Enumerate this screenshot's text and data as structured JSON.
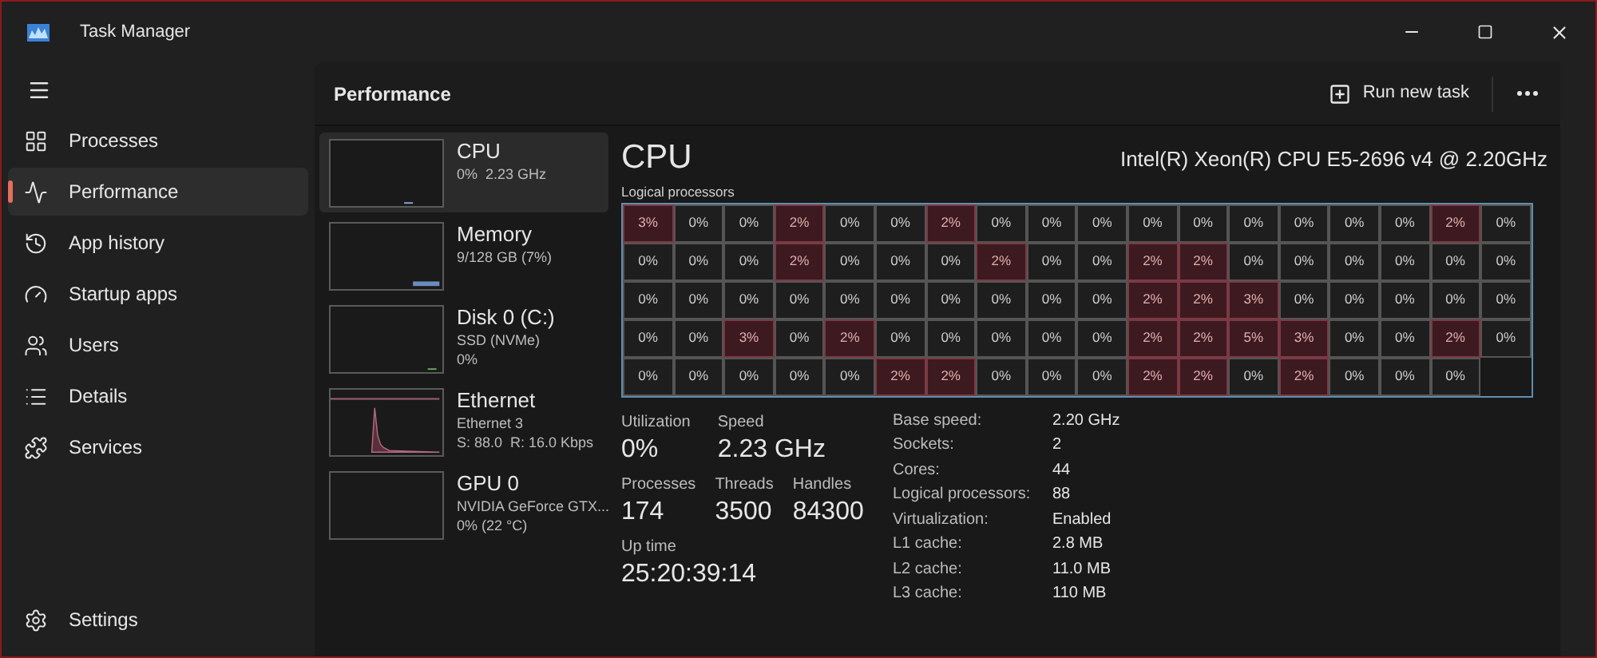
{
  "window": {
    "title": "Task Manager"
  },
  "sidebar": {
    "items": [
      {
        "label": "Processes",
        "kind": "processes",
        "selected": false
      },
      {
        "label": "Performance",
        "kind": "performance",
        "selected": true
      },
      {
        "label": "App history",
        "kind": "history",
        "selected": false
      },
      {
        "label": "Startup apps",
        "kind": "startup",
        "selected": false
      },
      {
        "label": "Users",
        "kind": "users",
        "selected": false
      },
      {
        "label": "Details",
        "kind": "details",
        "selected": false
      },
      {
        "label": "Services",
        "kind": "services",
        "selected": false
      }
    ],
    "footer": {
      "label": "Settings"
    }
  },
  "header": {
    "title": "Performance",
    "run_new_task": "Run new task"
  },
  "devices": [
    {
      "name": "CPU",
      "lines": [
        "0%  2.23 GHz"
      ],
      "kind": "cpu",
      "selected": true
    },
    {
      "name": "Memory",
      "lines": [
        "9/128 GB (7%)"
      ],
      "kind": "memory",
      "selected": false
    },
    {
      "name": "Disk 0 (C:)",
      "lines": [
        "SSD (NVMe)",
        "0%"
      ],
      "kind": "disk",
      "selected": false
    },
    {
      "name": "Ethernet",
      "lines": [
        "Ethernet 3",
        "S: 88.0  R: 16.0 Kbps"
      ],
      "kind": "ethernet",
      "selected": false
    },
    {
      "name": "GPU 0",
      "lines": [
        "NVIDIA GeForce GTX...",
        "0% (22 °C)"
      ],
      "kind": "gpu",
      "selected": false
    }
  ],
  "cpu": {
    "title": "CPU",
    "model": "Intel(R) Xeon(R) CPU E5-2696 v4 @ 2.20GHz",
    "grid_label": "Logical processors",
    "grid": [
      [
        "3%",
        "0%",
        "0%",
        "2%",
        "0%",
        "0%",
        "2%",
        "0%",
        "0%",
        "0%",
        "0%",
        "0%",
        "0%",
        "0%",
        "0%",
        "0%",
        "2%",
        "0%"
      ],
      [
        "0%",
        "0%",
        "0%",
        "2%",
        "0%",
        "0%",
        "0%",
        "2%",
        "0%",
        "0%",
        "2%",
        "2%",
        "0%",
        "0%",
        "0%",
        "0%",
        "0%",
        "0%"
      ],
      [
        "0%",
        "0%",
        "0%",
        "0%",
        "0%",
        "0%",
        "0%",
        "0%",
        "0%",
        "0%",
        "2%",
        "2%",
        "3%",
        "0%",
        "0%",
        "0%",
        "0%",
        "0%"
      ],
      [
        "0%",
        "0%",
        "3%",
        "0%",
        "2%",
        "0%",
        "0%",
        "0%",
        "0%",
        "0%",
        "2%",
        "2%",
        "5%",
        "3%",
        "0%",
        "0%",
        "2%",
        "0%"
      ],
      [
        "0%",
        "0%",
        "0%",
        "0%",
        "0%",
        "2%",
        "2%",
        "0%",
        "0%",
        "0%",
        "2%",
        "2%",
        "0%",
        "2%",
        "0%",
        "0%",
        "0%"
      ]
    ],
    "busy": [
      [
        true,
        false,
        false,
        true,
        false,
        false,
        true,
        false,
        false,
        false,
        false,
        false,
        false,
        false,
        false,
        false,
        true,
        false
      ],
      [
        false,
        false,
        false,
        true,
        false,
        false,
        false,
        true,
        false,
        false,
        true,
        true,
        false,
        false,
        false,
        false,
        false,
        false
      ],
      [
        false,
        false,
        false,
        false,
        false,
        false,
        false,
        false,
        false,
        false,
        true,
        true,
        true,
        false,
        false,
        false,
        false,
        false
      ],
      [
        false,
        false,
        true,
        false,
        true,
        false,
        false,
        false,
        false,
        false,
        true,
        true,
        true,
        true,
        false,
        false,
        true,
        false
      ],
      [
        false,
        false,
        false,
        false,
        false,
        true,
        true,
        false,
        false,
        false,
        true,
        true,
        false,
        true,
        false,
        false,
        false
      ]
    ],
    "stats_top": [
      {
        "label": "Utilization",
        "value": "0%"
      },
      {
        "label": "Speed",
        "value": "2.23 GHz"
      }
    ],
    "stats_mid": [
      {
        "label": "Processes",
        "value": "174"
      },
      {
        "label": "Threads",
        "value": "3500"
      },
      {
        "label": "Handles",
        "value": "84300"
      }
    ],
    "uptime": {
      "label": "Up time",
      "value": "25:20:39:14"
    },
    "specs": [
      {
        "label": "Base speed:",
        "value": "2.20 GHz"
      },
      {
        "label": "Sockets:",
        "value": "2"
      },
      {
        "label": "Cores:",
        "value": "44"
      },
      {
        "label": "Logical processors:",
        "value": "88"
      },
      {
        "label": "Virtualization:",
        "value": "Enabled"
      },
      {
        "label": "L1 cache:",
        "value": "2.8 MB"
      },
      {
        "label": "L2 cache:",
        "value": "11.0 MB"
      },
      {
        "label": "L3 cache:",
        "value": "110 MB"
      }
    ]
  }
}
